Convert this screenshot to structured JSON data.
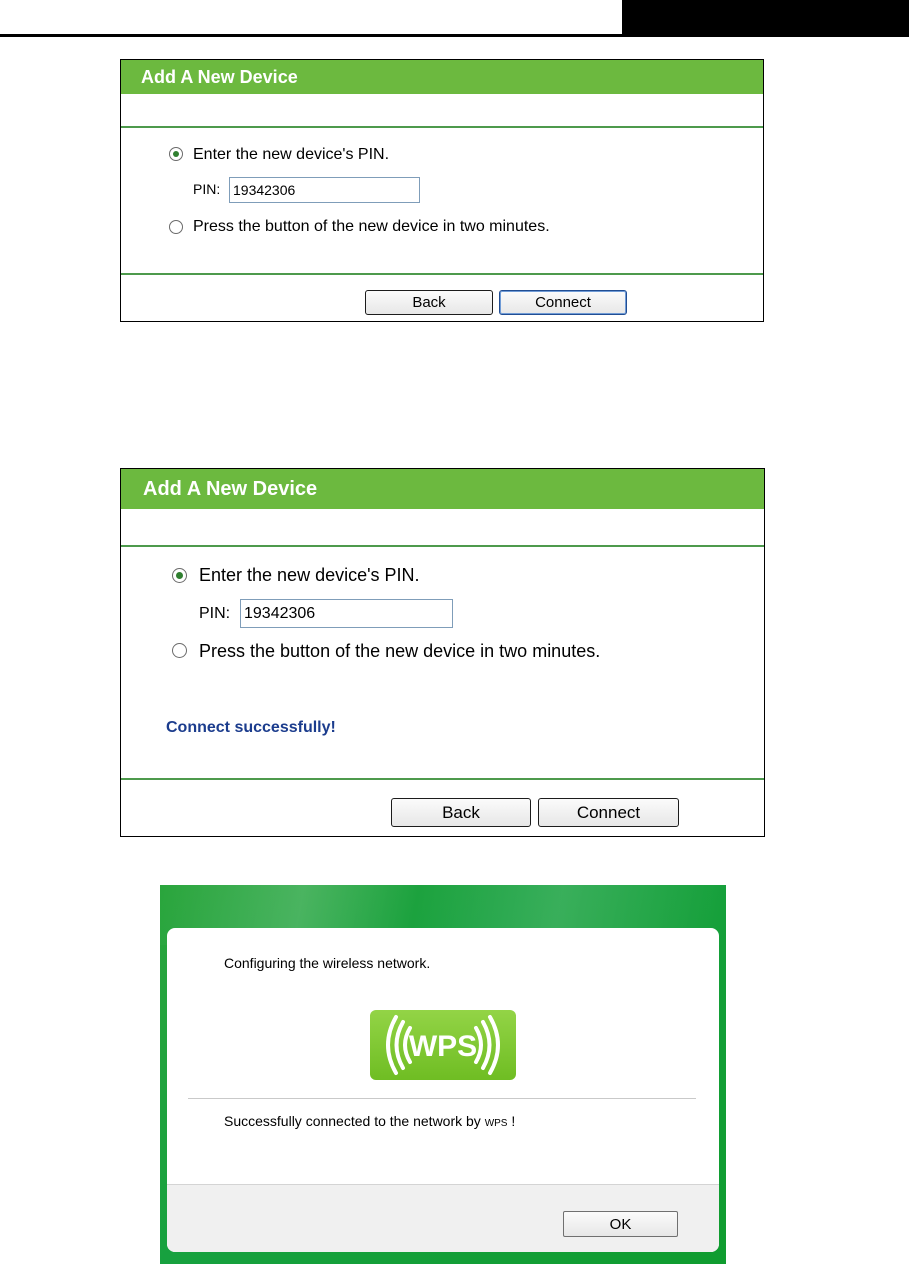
{
  "panel_top": {
    "title": "Add A New Device",
    "option_pin_label": "Enter the new device's PIN.",
    "pin_label": "PIN:",
    "pin_value": "19342306",
    "option_push_label": "Press the button of the new device in two minutes.",
    "back_label": "Back",
    "connect_label": "Connect"
  },
  "panel_bottom": {
    "title": "Add A New Device",
    "option_pin_label": "Enter the new device's PIN.",
    "pin_label": "PIN:",
    "pin_value": "19342306",
    "option_push_label": "Press the button of the new device in two minutes.",
    "status_message": "Connect successfully!",
    "back_label": "Back",
    "connect_label": "Connect"
  },
  "wps_dialog": {
    "configuring_text": "Configuring the wireless network.",
    "logo_text": "WPS",
    "success_text_prefix": "Successfully connected to the network by",
    "success_text_wps": "WPS",
    "success_text_suffix": "!",
    "ok_label": "OK"
  },
  "colors": {
    "title_bar": "#6cb93f",
    "divider": "#4d9a4c",
    "status_text": "#1b3c8d",
    "dialog_background": "#17a13f",
    "wps_logo": "#7fc733"
  }
}
